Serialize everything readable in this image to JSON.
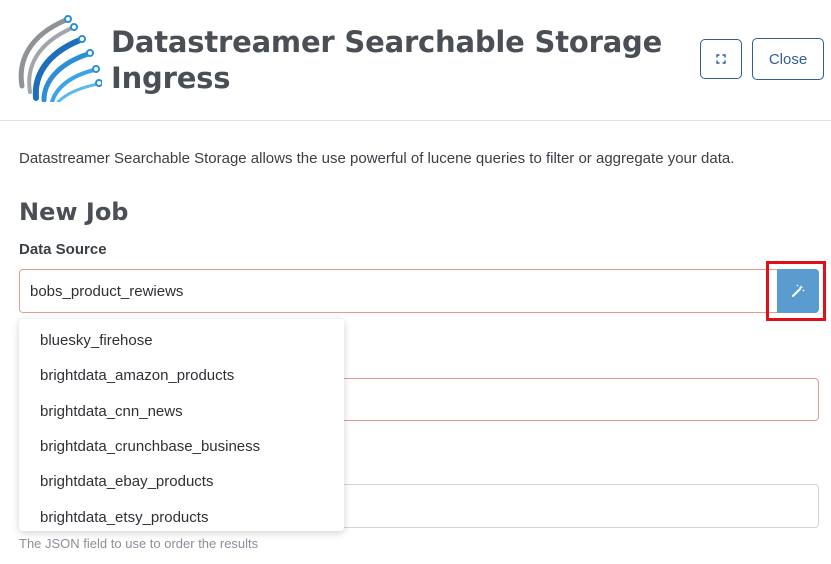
{
  "header": {
    "title": "Datastreamer Searchable Storage Ingress",
    "close_label": "Close"
  },
  "main": {
    "description": "Datastreamer Searchable Storage allows the use powerful of lucene queries to filter or aggregate your data.",
    "section_title": "New Job",
    "data_source": {
      "label": "Data Source",
      "value": "bobs_product_rewiews"
    },
    "help_text": "The JSON field to use to order the results"
  },
  "dropdown": {
    "items": [
      "bluesky_firehose",
      "brightdata_amazon_products",
      "brightdata_cnn_news",
      "brightdata_crunchbase_business",
      "brightdata_ebay_products",
      "brightdata_etsy_products"
    ]
  },
  "colors": {
    "accent": "#2f5f93",
    "wand_button": "#5a9bd0",
    "error_border": "#e89a8e",
    "highlight": "#e0101a"
  },
  "icons": {
    "logo": "datastreamer-logo",
    "expand": "expand-icon",
    "wand": "magic-wand-icon"
  }
}
